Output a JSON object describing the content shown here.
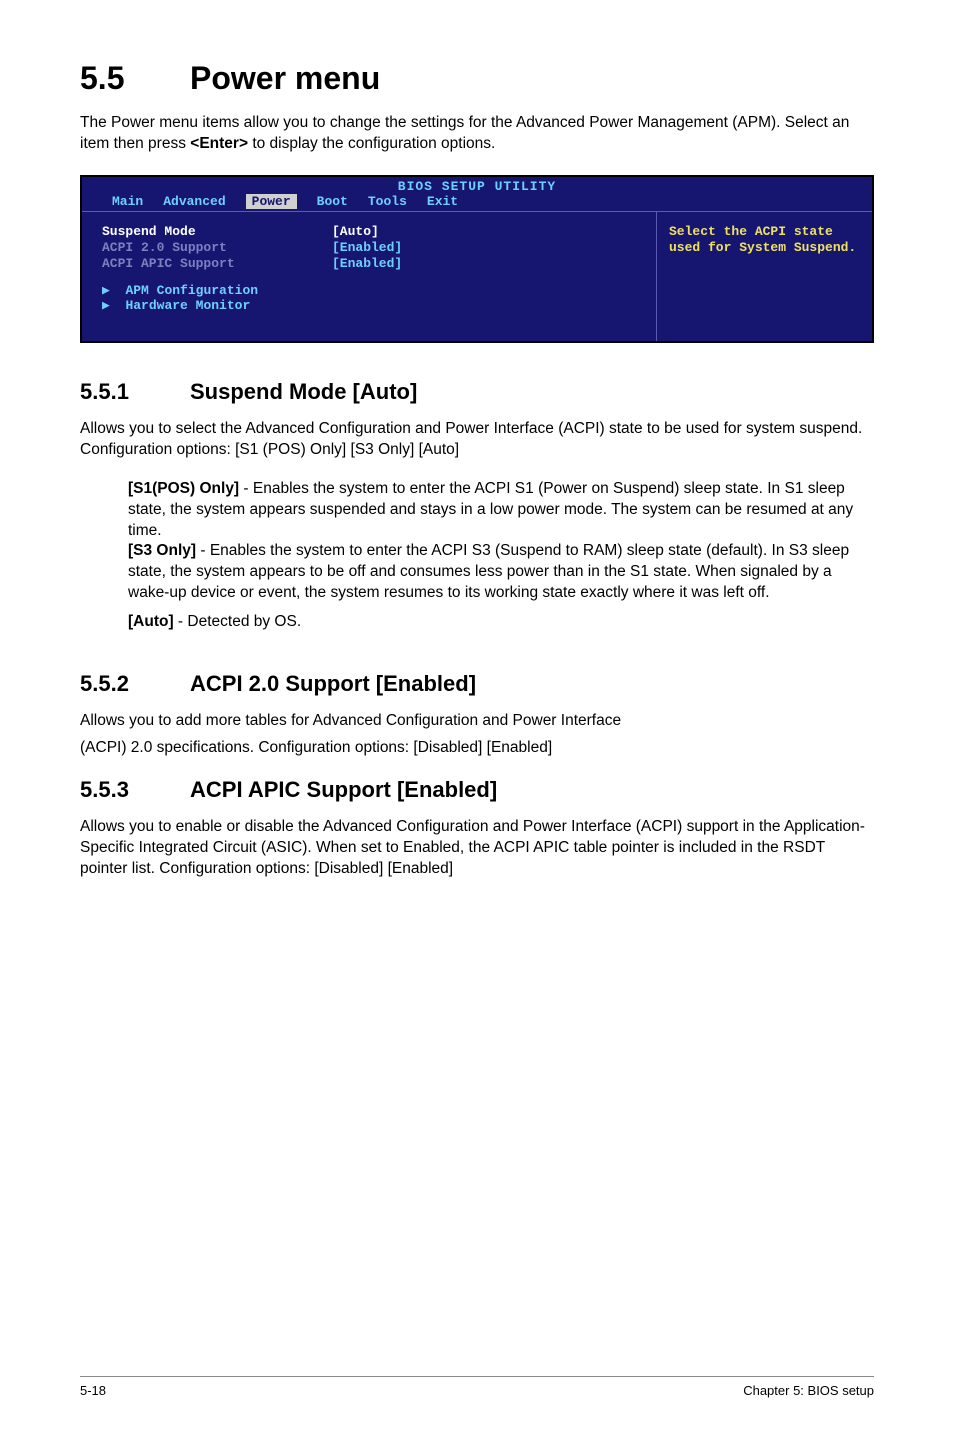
{
  "h1_number": "5.5",
  "h1_title": "Power menu",
  "intro_before": "The Power menu items allow you to change the settings for the Advanced Power Management (APM). Select an item then press ",
  "intro_bold": "<Enter>",
  "intro_after": " to display the configuration options.",
  "bios": {
    "header": "BIOS SETUP UTILITY",
    "tabs": {
      "main": "Main",
      "advanced": "Advanced",
      "power": "Power",
      "boot": "Boot",
      "tools": "Tools",
      "exit": "Exit"
    },
    "rows": {
      "suspend_label": "Suspend Mode",
      "suspend_value": "[Auto]",
      "acpi20_label": "ACPI 2.0 Support",
      "acpi20_value": "[Enabled]",
      "apic_label": "ACPI APIC Support",
      "apic_value": "[Enabled]"
    },
    "sub": {
      "apm": "APM Configuration",
      "hw": "Hardware Monitor"
    },
    "help": "Select the ACPI state used for System Suspend."
  },
  "s551": {
    "number": "5.5.1",
    "title": "Suspend Mode [Auto]",
    "body": "Allows you to select the Advanced Configuration and Power Interface (ACPI) state to be used for system suspend. Configuration options: [S1 (POS) Only] [S3 Only] [Auto]",
    "p1_bold": "[S1(POS) Only]",
    "p1_text": " - Enables the system to enter the ACPI S1 (Power on Suspend) sleep state. In S1 sleep state, the system appears suspended and stays in a low power mode. The system can be resumed at any time.",
    "p2_bold": "[S3 Only]",
    "p2_text": " - Enables the system to enter the ACPI S3 (Suspend to RAM) sleep state (default). In S3 sleep state, the system appears to be off and consumes less power than in the S1 state. When signaled by a wake-up device or event, the system resumes to its working state exactly where it was left off.",
    "p3_bold": "[Auto]",
    "p3_text": " - Detected by OS."
  },
  "s552": {
    "number": "5.5.2",
    "title": "ACPI 2.0 Support [Enabled]",
    "line1": "Allows you to add more tables for Advanced Configuration and Power Interface",
    "line2": "(ACPI) 2.0 specifications. Configuration options: [Disabled] [Enabled]"
  },
  "s553": {
    "number": "5.5.3",
    "title": "ACPI APIC Support [Enabled]",
    "body": "Allows you to enable or disable the Advanced Configuration and Power Interface (ACPI) support in the Application-Specific Integrated Circuit (ASIC). When set to Enabled, the ACPI APIC table pointer is included in the RSDT pointer list. Configuration options: [Disabled] [Enabled]"
  },
  "footer": {
    "left": "5-18",
    "right": "Chapter 5: BIOS setup"
  }
}
